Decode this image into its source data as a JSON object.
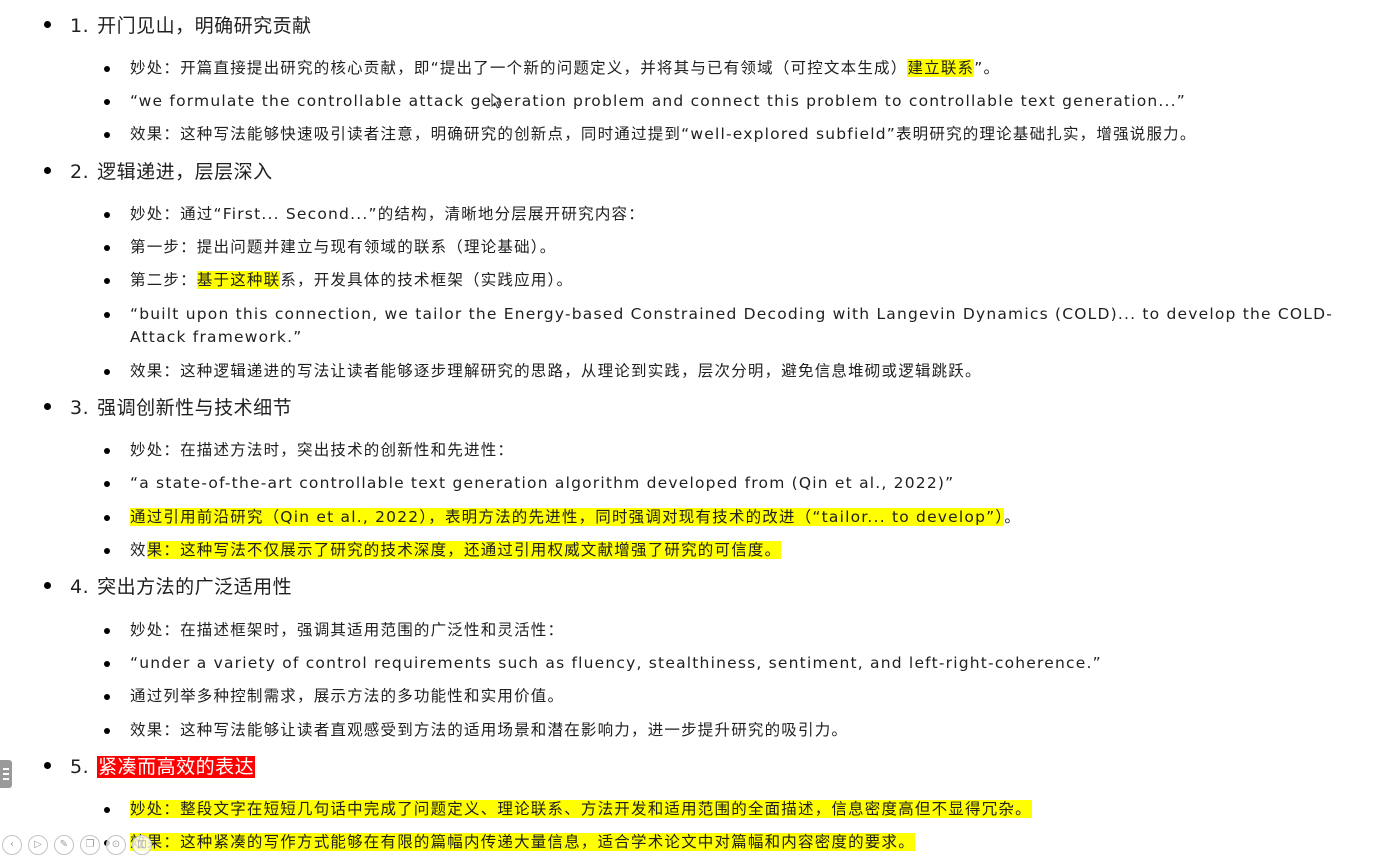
{
  "sections": [
    {
      "num": "1.",
      "title": "开门见山，明确研究贡献",
      "items": [
        {
          "parts": [
            {
              "t": "妙处：开篇直接提出研究的核心贡献，即“提出了一个新的问题定义，并将其与已有领域（可控文本生成）"
            },
            {
              "t": "建立联系",
              "hl": true
            },
            {
              "t": "”。"
            }
          ]
        },
        {
          "parts": [
            {
              "t": "“we formulate the controllable attack generation problem and connect this problem to controllable text generation...”"
            }
          ]
        },
        {
          "parts": [
            {
              "t": "效果：这种写法能够快速吸引读者注意，明确研究的创新点，同时通过提到“well-explored subfield”表明研究的理论基础扎实，增强说服力。"
            }
          ]
        }
      ]
    },
    {
      "num": "2.",
      "title": "逻辑递进，层层深入",
      "items": [
        {
          "parts": [
            {
              "t": "妙处：通过“First... Second...”的结构，清晰地分层展开研究内容："
            }
          ]
        },
        {
          "parts": [
            {
              "t": "第一步：提出问题并建立与现有领域的联系（理论基础）。"
            }
          ]
        },
        {
          "parts": [
            {
              "t": "第二步："
            },
            {
              "t": "基于这种联",
              "hl": true
            },
            {
              "t": "系，开发具体的技术框架（实践应用）。"
            }
          ]
        },
        {
          "wrap": true,
          "parts": [
            {
              "t": "“built upon this connection, we tailor the Energy-based Constrained Decoding with Langevin Dynamics (COLD)... to develop the COLD-Attack framework.”"
            }
          ]
        },
        {
          "parts": [
            {
              "t": "效果：这种逻辑递进的写法让读者能够逐步理解研究的思路，从理论到实践，层次分明，避免信息堆砌或逻辑跳跃。"
            }
          ]
        }
      ]
    },
    {
      "num": "3.",
      "title": "强调创新性与技术细节",
      "items": [
        {
          "parts": [
            {
              "t": "妙处：在描述方法时，突出技术的创新性和先进性："
            }
          ]
        },
        {
          "parts": [
            {
              "t": "“a state-of-the-art controllable text generation algorithm developed from (Qin et al., 2022)”"
            }
          ]
        },
        {
          "parts": [
            {
              "t": "通过引用前沿研究（Qin et al., 2022），表明方法的先进性，同时强调对现有技术的改进（“tailor... to develop”）",
              "hl": true
            },
            {
              "t": "。"
            }
          ]
        },
        {
          "parts": [
            {
              "t": "效"
            },
            {
              "t": "果：这种写法不仅展示了研究的技术深度，还通过引用权威文献增强了研究的可信度。",
              "hl": true
            }
          ]
        }
      ]
    },
    {
      "num": "4.",
      "title": "突出方法的广泛适用性",
      "items": [
        {
          "parts": [
            {
              "t": "妙处：在描述框架时，强调其适用范围的广泛性和灵活性："
            }
          ]
        },
        {
          "parts": [
            {
              "t": "“under a variety of control requirements such as fluency, stealthiness, sentiment, and left-right-coherence.”"
            }
          ]
        },
        {
          "parts": [
            {
              "t": "通过列举多种控制需求，展示方法的多功能性和实用价值。"
            }
          ]
        },
        {
          "parts": [
            {
              "t": "效果：这种写法能够让读者直观感受到方法的适用场景和潜在影响力，进一步提升研究的吸引力。"
            }
          ]
        }
      ]
    },
    {
      "num": "5.",
      "title": "紧凑而高效的表达",
      "title_hl": "red",
      "items": [
        {
          "parts": [
            {
              "t": "妙处：整段文字在短短几句话中完成了问题定义、理论联系、方法开发和适用范围的全面描述，信息密度高但不显得冗杂。",
              "hl": true
            }
          ]
        },
        {
          "parts": [
            {
              "t": "效果：这种紧凑的写作方式能够在有限的篇幅内传递大量信息，适合学术论文中对篇幅和内容密度的要求。",
              "hl": true
            }
          ]
        }
      ]
    }
  ],
  "toolbar": {
    "buttons": [
      {
        "icon": "previous-icon",
        "glyph": "‹"
      },
      {
        "icon": "play-icon",
        "glyph": "▷"
      },
      {
        "icon": "pen-icon",
        "glyph": "✎"
      },
      {
        "icon": "copy-icon",
        "glyph": "❐"
      },
      {
        "icon": "zoom-icon",
        "glyph": "⊙"
      },
      {
        "icon": "camera-icon",
        "glyph": "◫"
      }
    ]
  },
  "colors": {
    "highlight": "#ffff00",
    "heading_highlight": "#ff0000",
    "text": "#1f1f1f"
  }
}
